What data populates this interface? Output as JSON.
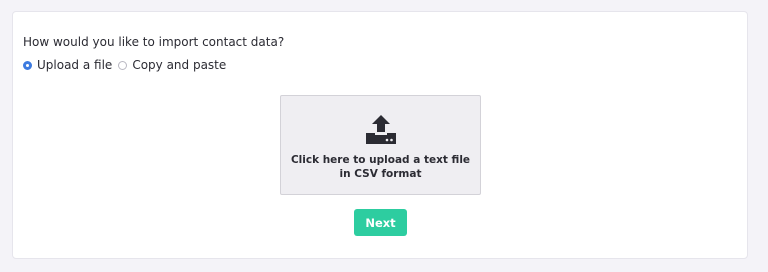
{
  "form": {
    "question": "How would you like to import contact data?",
    "options": [
      {
        "label": "Upload a file",
        "checked": true
      },
      {
        "label": "Copy and paste",
        "checked": false
      }
    ]
  },
  "upload": {
    "icon": "upload-icon",
    "line1": "Click here to upload a text file",
    "line2": "in CSV format"
  },
  "actions": {
    "next_label": "Next"
  },
  "colors": {
    "accent": "#2dcda0",
    "radio_checked": "#3d7be0",
    "page_background": "#f4f3f8"
  }
}
